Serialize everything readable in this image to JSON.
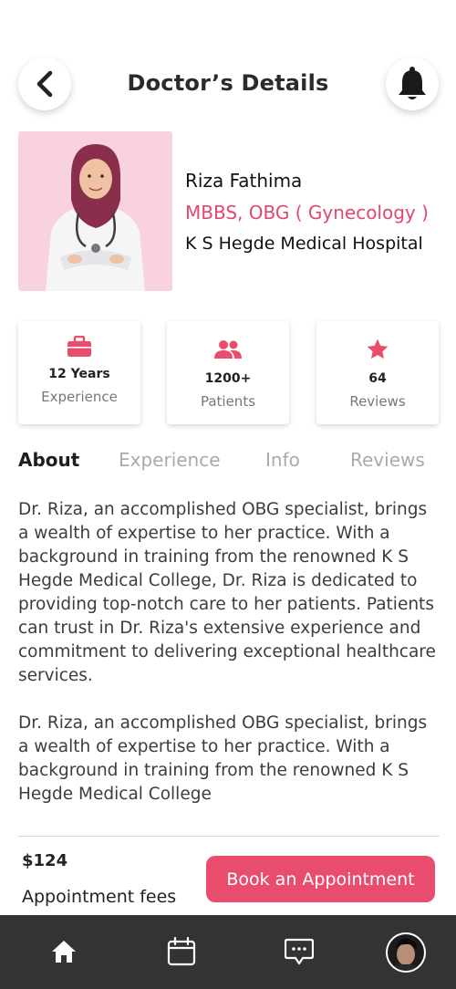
{
  "header": {
    "title": "Doctor’s Details",
    "back_icon": "chevron-left-icon",
    "bell_icon": "bell-icon"
  },
  "doctor": {
    "name": "Riza Fathima",
    "degree": "MBBS, OBG ( Gynecology )",
    "hospital": "K S Hegde Medical Hospital"
  },
  "stats": [
    {
      "icon": "briefcase-icon",
      "value": "12 Years",
      "label": "Experience"
    },
    {
      "icon": "users-icon",
      "value": "1200+",
      "label": "Patients"
    },
    {
      "icon": "star-icon",
      "value": "64",
      "label": "Reviews"
    }
  ],
  "tabs": [
    {
      "label": "About",
      "active": true
    },
    {
      "label": "Experience",
      "active": false
    },
    {
      "label": "Info",
      "active": false
    },
    {
      "label": "Reviews",
      "active": false
    }
  ],
  "about": {
    "paragraph1": "Dr. Riza, an accomplished OBG specialist, brings a wealth of expertise to her practice. With a background in training from the renowned K S Hegde Medical College, Dr. Riza is dedicated to providing top-notch care to her patients. Patients can trust in Dr. Riza's extensive experience and commitment to delivering exceptional healthcare services.",
    "paragraph2": "Dr. Riza, an accomplished OBG specialist, brings a wealth of expertise to her practice. With a background in training from the renowned K S Hegde Medical College"
  },
  "booking": {
    "fee": "$124",
    "fee_label": "Appointment fees",
    "button_label": "Book an Appointment"
  },
  "navbar": {
    "items": [
      "home-icon",
      "calendar-icon",
      "chat-icon",
      "profile-avatar"
    ]
  },
  "colors": {
    "accent": "#e84d6e",
    "navbar": "#333333",
    "photo_bg": "#f8d3dd"
  }
}
